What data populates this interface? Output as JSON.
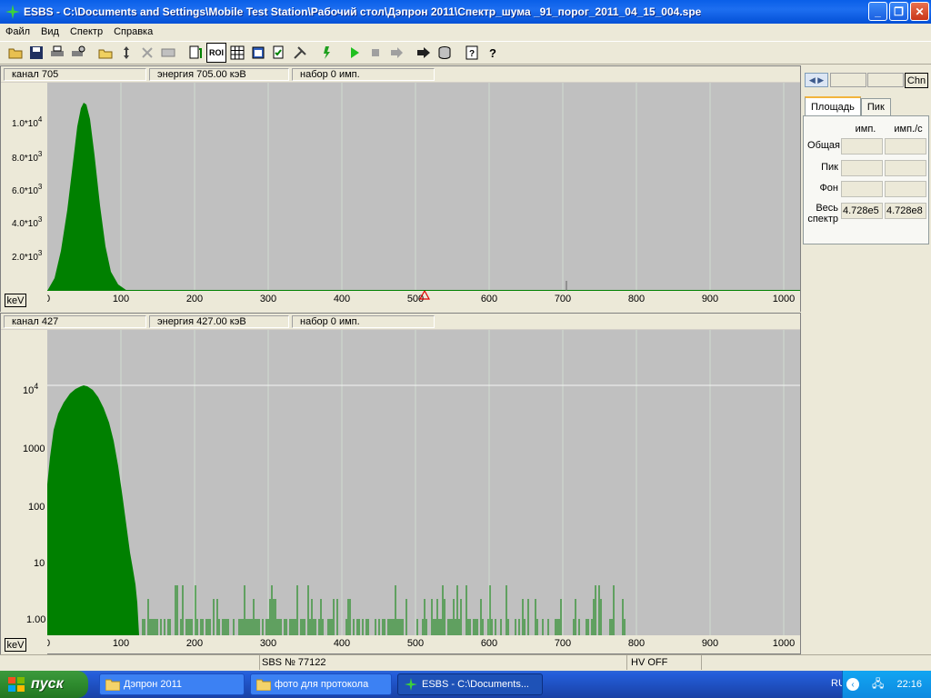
{
  "window": {
    "title": "ESBS - C:\\Documents and Settings\\Mobile Test Station\\Рабочий стол\\Дэпрон 2011\\Спектр_шума _91_порог_2011_04_15_004.spe",
    "minimize": "_",
    "maximize": "❐",
    "close": "✕"
  },
  "menu": [
    "Файл",
    "Вид",
    "Спектр",
    "Справка"
  ],
  "toolbar": {
    "roi_label": "ROI"
  },
  "top_panel": {
    "channel": "канал 705",
    "energy": "энергия 705.00 кэВ",
    "counts": "набор     0 имп.",
    "unit_button": "keV",
    "y_ticks": [
      "1.0*10^4",
      "8.0*10^3",
      "6.0*10^3",
      "4.0*10^3",
      "2.0*10^3"
    ],
    "x_ticks": [
      "0",
      "100",
      "200",
      "300",
      "400",
      "500",
      "600",
      "700",
      "800",
      "900",
      "1000"
    ]
  },
  "bottom_panel": {
    "channel": "канал 427",
    "energy": "энергия 427.00 кэВ",
    "counts": "набор     0 имп.",
    "unit_button": "keV",
    "y_ticks": [
      "10^4",
      "1000",
      "100",
      "10",
      "1.00"
    ],
    "x_ticks": [
      "0",
      "100",
      "200",
      "300",
      "400",
      "500",
      "600",
      "700",
      "800",
      "900",
      "1000"
    ]
  },
  "right_panel": {
    "chn_button": "Chn",
    "tabs": [
      "Площадь",
      "Пик"
    ],
    "col_headers": [
      "имп.",
      "имп./с"
    ],
    "rows": [
      {
        "label": "Общая",
        "counts": "",
        "rate": ""
      },
      {
        "label": "Пик",
        "counts": "",
        "rate": ""
      },
      {
        "label": "Фон",
        "counts": "",
        "rate": ""
      },
      {
        "label": "Весь спектр",
        "counts": "4.728e5",
        "rate": "4.728e8"
      }
    ]
  },
  "statusbar": {
    "serial": "SBS № 77122",
    "hv": "HV OFF"
  },
  "taskbar": {
    "start": "пуск",
    "tasks": [
      "Дэпрон 2011",
      "фото для протокола",
      "ESBS - C:\\Documents..."
    ],
    "lang": "RU",
    "clock": "22:16"
  },
  "colors": {
    "spectrum": "#008000",
    "plot_bg": "#c0c0c0",
    "title_bar": "#0a5fe8"
  }
}
